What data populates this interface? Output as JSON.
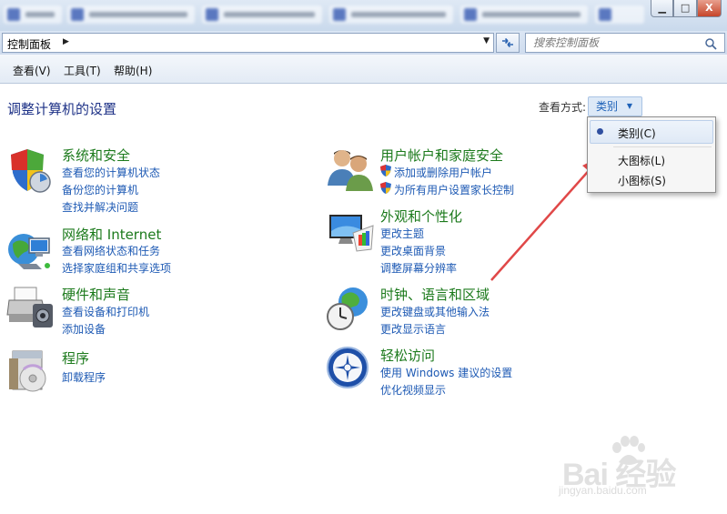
{
  "window": {
    "buttons": {
      "minimize": "▁",
      "maximize": "□",
      "close": "X"
    }
  },
  "address": {
    "crumb": "控制面板",
    "arrow": "▶",
    "dropdown": "▼",
    "refresh_icon": "refresh-icon"
  },
  "search": {
    "placeholder": "搜索控制面板",
    "value": ""
  },
  "menu": {
    "view": "查看(V)",
    "tools": "工具(T)",
    "help": "帮助(H)"
  },
  "main": {
    "title": "调整计算机的设置",
    "view_by_label": "查看方式:",
    "view_by_value": "类别",
    "view_by_caret": "▼"
  },
  "view_menu": {
    "items": [
      {
        "label": "类别(C)",
        "selected": true
      },
      {
        "label": "大图标(L)",
        "selected": false
      },
      {
        "label": "小图标(S)",
        "selected": false
      }
    ]
  },
  "categories": [
    {
      "title": "系统和安全",
      "icon": "shield-icon",
      "links": [
        "查看您的计算机状态",
        "备份您的计算机",
        "查找并解决问题"
      ]
    },
    {
      "title": "网络和 Internet",
      "icon": "globe-network-icon",
      "links": [
        "查看网络状态和任务",
        "选择家庭组和共享选项"
      ]
    },
    {
      "title": "硬件和声音",
      "icon": "printer-icon",
      "links": [
        "查看设备和打印机",
        "添加设备"
      ]
    },
    {
      "title": "程序",
      "icon": "programs-icon",
      "links": [
        "卸载程序"
      ]
    },
    {
      "title": "用户帐户和家庭安全",
      "icon": "users-icon",
      "links": [
        "添加或删除用户帐户",
        "为所有用户设置家长控制"
      ]
    },
    {
      "title": "外观和个性化",
      "icon": "monitor-icon",
      "links": [
        "更改主题",
        "更改桌面背景",
        "调整屏幕分辨率"
      ]
    },
    {
      "title": "时钟、语言和区域",
      "icon": "clock-globe-icon",
      "links": [
        "更改键盘或其他输入法",
        "更改显示语言"
      ]
    },
    {
      "title": "轻松访问",
      "icon": "accessibility-icon",
      "links": [
        "使用 Windows 建议的设置",
        "优化视频显示"
      ]
    }
  ],
  "watermark": {
    "brand": "Bai 经验",
    "sub": "jingyan.baidu.com"
  },
  "colors": {
    "category_title": "#1c7a1c",
    "link": "#1e5ab4",
    "page_title": "#1e3287",
    "annotation_arrow": "#e04848"
  }
}
